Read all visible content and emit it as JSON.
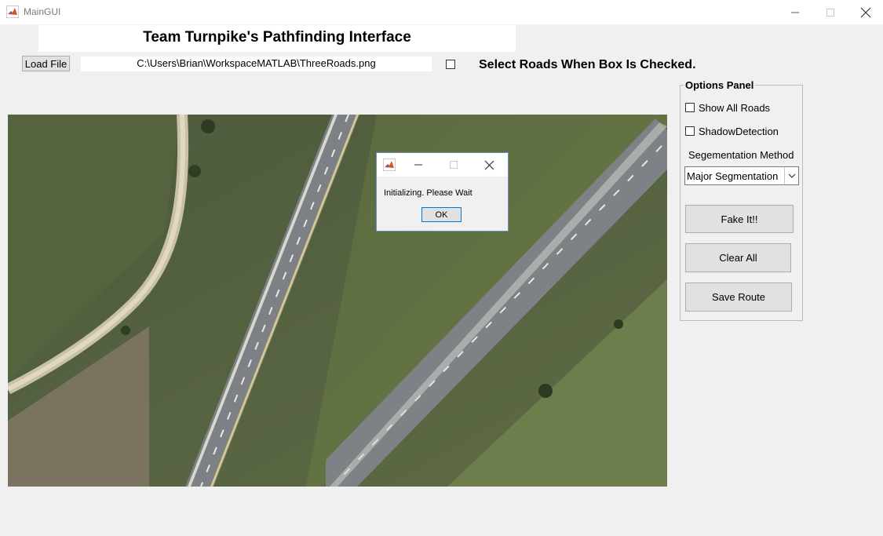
{
  "window": {
    "title": "MainGUI",
    "icon": "matlab-icon",
    "controls": [
      "minimize-icon",
      "maximize-icon",
      "close-icon"
    ]
  },
  "header": {
    "title": "Team Turnpike's Pathfinding Interface"
  },
  "toolbar": {
    "load_label": "Load File",
    "file_path": "C:\\Users\\Brian\\WorkspaceMATLAB\\ThreeRoads.png",
    "select_checked": false,
    "select_label": "Select Roads When Box Is Checked."
  },
  "image": {
    "description_icon": "aerial-road-image"
  },
  "options_panel": {
    "title": "Options Panel",
    "show_all_roads_label": "Show All Roads",
    "show_all_roads_checked": false,
    "shadow_detection_label": "ShadowDetection",
    "shadow_detection_checked": false,
    "segmentation_label": "Segementation Method",
    "segmentation_value": "Major Segmentation",
    "buttons": {
      "fake_it": "Fake It!!",
      "clear_all": "Clear All",
      "save_route": "Save Route"
    }
  },
  "dialog": {
    "message": "Initializing. Please Wait",
    "ok_label": "OK"
  },
  "colors": {
    "background": "#f0f0f0",
    "button": "#e1e1e1",
    "dialog_border": "#6d8fbf",
    "ok_focus": "#0078d7"
  }
}
